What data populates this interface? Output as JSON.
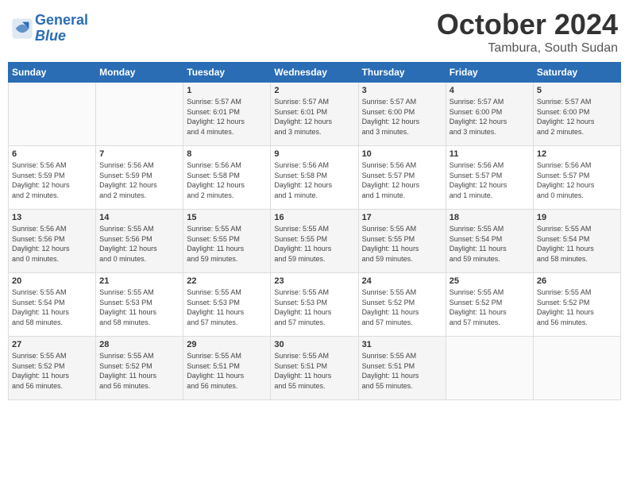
{
  "header": {
    "logo_line1": "General",
    "logo_line2": "Blue",
    "month": "October 2024",
    "location": "Tambura, South Sudan"
  },
  "weekdays": [
    "Sunday",
    "Monday",
    "Tuesday",
    "Wednesday",
    "Thursday",
    "Friday",
    "Saturday"
  ],
  "weeks": [
    [
      {
        "day": "",
        "info": ""
      },
      {
        "day": "",
        "info": ""
      },
      {
        "day": "1",
        "info": "Sunrise: 5:57 AM\nSunset: 6:01 PM\nDaylight: 12 hours\nand 4 minutes."
      },
      {
        "day": "2",
        "info": "Sunrise: 5:57 AM\nSunset: 6:01 PM\nDaylight: 12 hours\nand 3 minutes."
      },
      {
        "day": "3",
        "info": "Sunrise: 5:57 AM\nSunset: 6:00 PM\nDaylight: 12 hours\nand 3 minutes."
      },
      {
        "day": "4",
        "info": "Sunrise: 5:57 AM\nSunset: 6:00 PM\nDaylight: 12 hours\nand 3 minutes."
      },
      {
        "day": "5",
        "info": "Sunrise: 5:57 AM\nSunset: 6:00 PM\nDaylight: 12 hours\nand 2 minutes."
      }
    ],
    [
      {
        "day": "6",
        "info": "Sunrise: 5:56 AM\nSunset: 5:59 PM\nDaylight: 12 hours\nand 2 minutes."
      },
      {
        "day": "7",
        "info": "Sunrise: 5:56 AM\nSunset: 5:59 PM\nDaylight: 12 hours\nand 2 minutes."
      },
      {
        "day": "8",
        "info": "Sunrise: 5:56 AM\nSunset: 5:58 PM\nDaylight: 12 hours\nand 2 minutes."
      },
      {
        "day": "9",
        "info": "Sunrise: 5:56 AM\nSunset: 5:58 PM\nDaylight: 12 hours\nand 1 minute."
      },
      {
        "day": "10",
        "info": "Sunrise: 5:56 AM\nSunset: 5:57 PM\nDaylight: 12 hours\nand 1 minute."
      },
      {
        "day": "11",
        "info": "Sunrise: 5:56 AM\nSunset: 5:57 PM\nDaylight: 12 hours\nand 1 minute."
      },
      {
        "day": "12",
        "info": "Sunrise: 5:56 AM\nSunset: 5:57 PM\nDaylight: 12 hours\nand 0 minutes."
      }
    ],
    [
      {
        "day": "13",
        "info": "Sunrise: 5:56 AM\nSunset: 5:56 PM\nDaylight: 12 hours\nand 0 minutes."
      },
      {
        "day": "14",
        "info": "Sunrise: 5:55 AM\nSunset: 5:56 PM\nDaylight: 12 hours\nand 0 minutes."
      },
      {
        "day": "15",
        "info": "Sunrise: 5:55 AM\nSunset: 5:55 PM\nDaylight: 11 hours\nand 59 minutes."
      },
      {
        "day": "16",
        "info": "Sunrise: 5:55 AM\nSunset: 5:55 PM\nDaylight: 11 hours\nand 59 minutes."
      },
      {
        "day": "17",
        "info": "Sunrise: 5:55 AM\nSunset: 5:55 PM\nDaylight: 11 hours\nand 59 minutes."
      },
      {
        "day": "18",
        "info": "Sunrise: 5:55 AM\nSunset: 5:54 PM\nDaylight: 11 hours\nand 59 minutes."
      },
      {
        "day": "19",
        "info": "Sunrise: 5:55 AM\nSunset: 5:54 PM\nDaylight: 11 hours\nand 58 minutes."
      }
    ],
    [
      {
        "day": "20",
        "info": "Sunrise: 5:55 AM\nSunset: 5:54 PM\nDaylight: 11 hours\nand 58 minutes."
      },
      {
        "day": "21",
        "info": "Sunrise: 5:55 AM\nSunset: 5:53 PM\nDaylight: 11 hours\nand 58 minutes."
      },
      {
        "day": "22",
        "info": "Sunrise: 5:55 AM\nSunset: 5:53 PM\nDaylight: 11 hours\nand 57 minutes."
      },
      {
        "day": "23",
        "info": "Sunrise: 5:55 AM\nSunset: 5:53 PM\nDaylight: 11 hours\nand 57 minutes."
      },
      {
        "day": "24",
        "info": "Sunrise: 5:55 AM\nSunset: 5:52 PM\nDaylight: 11 hours\nand 57 minutes."
      },
      {
        "day": "25",
        "info": "Sunrise: 5:55 AM\nSunset: 5:52 PM\nDaylight: 11 hours\nand 57 minutes."
      },
      {
        "day": "26",
        "info": "Sunrise: 5:55 AM\nSunset: 5:52 PM\nDaylight: 11 hours\nand 56 minutes."
      }
    ],
    [
      {
        "day": "27",
        "info": "Sunrise: 5:55 AM\nSunset: 5:52 PM\nDaylight: 11 hours\nand 56 minutes."
      },
      {
        "day": "28",
        "info": "Sunrise: 5:55 AM\nSunset: 5:52 PM\nDaylight: 11 hours\nand 56 minutes."
      },
      {
        "day": "29",
        "info": "Sunrise: 5:55 AM\nSunset: 5:51 PM\nDaylight: 11 hours\nand 56 minutes."
      },
      {
        "day": "30",
        "info": "Sunrise: 5:55 AM\nSunset: 5:51 PM\nDaylight: 11 hours\nand 55 minutes."
      },
      {
        "day": "31",
        "info": "Sunrise: 5:55 AM\nSunset: 5:51 PM\nDaylight: 11 hours\nand 55 minutes."
      },
      {
        "day": "",
        "info": ""
      },
      {
        "day": "",
        "info": ""
      }
    ]
  ]
}
